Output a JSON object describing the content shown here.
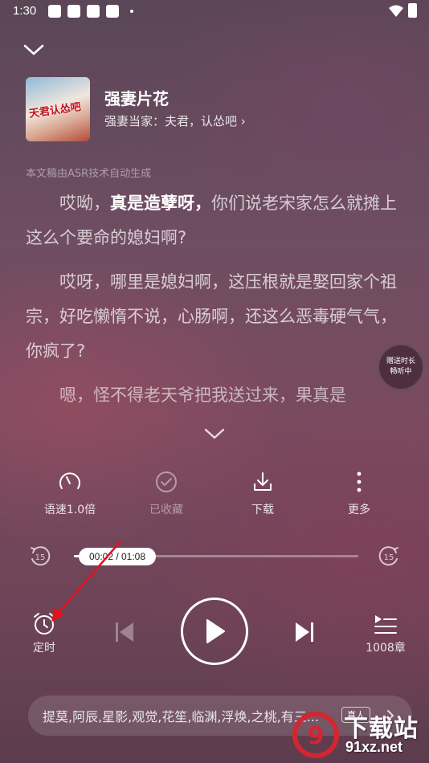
{
  "status_bar": {
    "time": "1:30"
  },
  "header": {
    "book_title": "强妻片花",
    "chapter_title": "强妻当家：夫君，认怂吧",
    "cover_text": "天君认怂吧"
  },
  "transcript": {
    "asr_note": "本文稿由ASR技术自动生成",
    "p1_before": "哎呦，",
    "p1_highlight": "真是造孽呀，",
    "p1_after": "你们说老宋家怎么就摊上这么个要命的媳妇啊?",
    "p2": "哎呀，哪里是媳妇啊，这压根就是娶回家个祖宗，好吃懒惰不说，心肠啊，还这么恶毒硬气气，你疯了?",
    "p3": "嗯，怪不得老天爷把我送过来，果真是"
  },
  "gift_bubble": {
    "line1": "赠送时长",
    "line2": "畅听中"
  },
  "actions": [
    {
      "label": "语速1.0倍",
      "icon": "speed-gauge-icon",
      "enabled": true
    },
    {
      "label": "已收藏",
      "icon": "check-circle-icon",
      "enabled": false
    },
    {
      "label": "下载",
      "icon": "download-icon",
      "enabled": true
    },
    {
      "label": "更多",
      "icon": "more-vertical-icon",
      "enabled": true
    }
  ],
  "progress": {
    "time_label": "00:02 / 01:08",
    "position_fraction": 0.03,
    "skip_seconds": "15"
  },
  "controls": {
    "timer_label": "定时",
    "chapters_label": "1008章"
  },
  "cast": {
    "text": "提莫,阿辰,星影,观觉,花笙,临渊,浮焕,之桃,有三...",
    "badge": "真人"
  },
  "watermark": {
    "brand": "下载站",
    "url": "91xz.net"
  },
  "colors": {
    "annotation_arrow": "#e0121e",
    "watermark_red": "#d42630"
  }
}
